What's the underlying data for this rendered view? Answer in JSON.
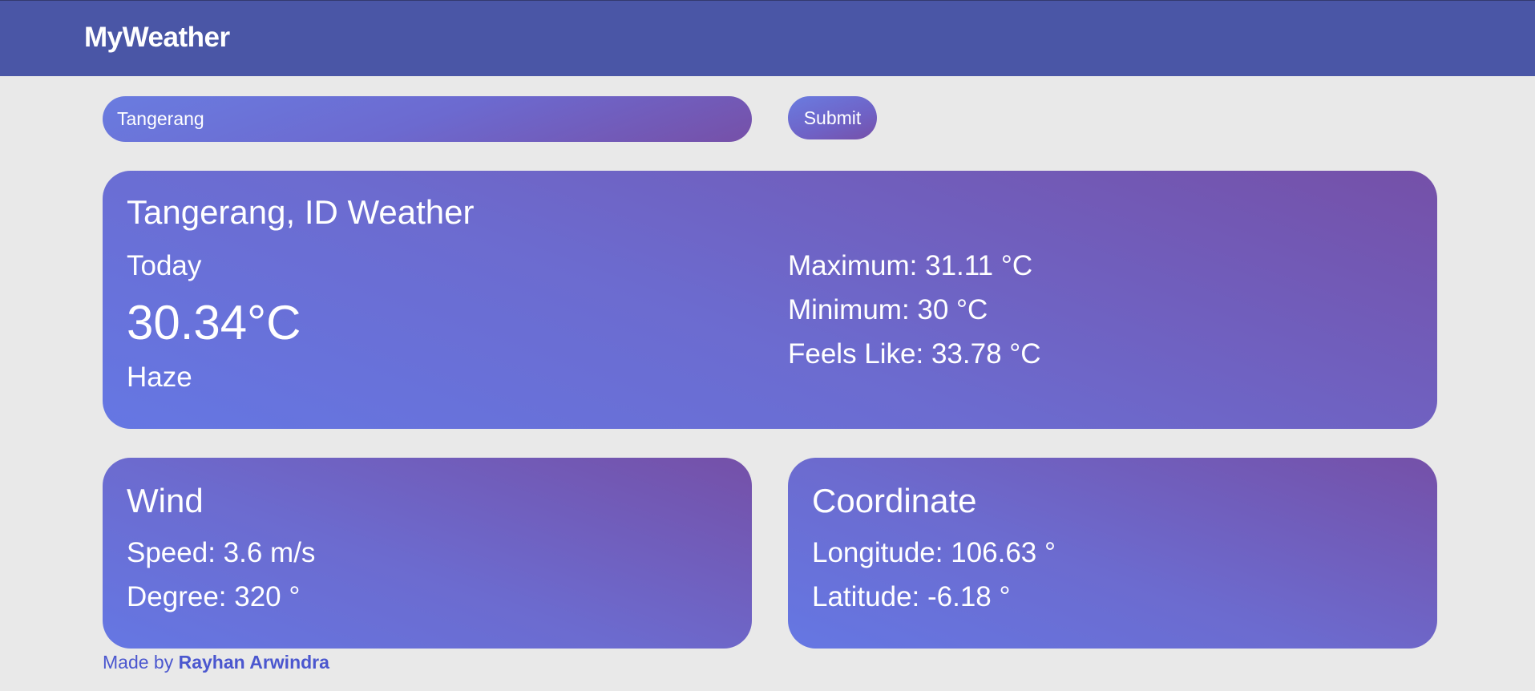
{
  "navbar": {
    "brand": "MyWeather"
  },
  "search": {
    "value": "Tangerang",
    "submit_label": "Submit"
  },
  "current": {
    "title": "Tangerang, ID Weather",
    "day_label": "Today",
    "temperature": "30.34°C",
    "condition": "Haze",
    "maximum": "Maximum: 31.11 °C",
    "minimum": "Minimum: 30 °C",
    "feels_like": "Feels Like: 33.78 °C"
  },
  "wind": {
    "title": "Wind",
    "speed": "Speed: 3.6 m/s",
    "degree": "Degree: 320 °"
  },
  "coordinate": {
    "title": "Coordinate",
    "longitude": "Longitude: 106.63 °",
    "latitude": "Latitude: -6.18 °"
  },
  "footer": {
    "prefix": "Made by ",
    "author": "Rayhan Arwindra"
  },
  "colors": {
    "navbar": "#4a56a6",
    "background": "#e9e9e9",
    "card_gradient_start": "#6577e3",
    "card_gradient_end": "#7550a8",
    "link": "#4b57cf"
  }
}
